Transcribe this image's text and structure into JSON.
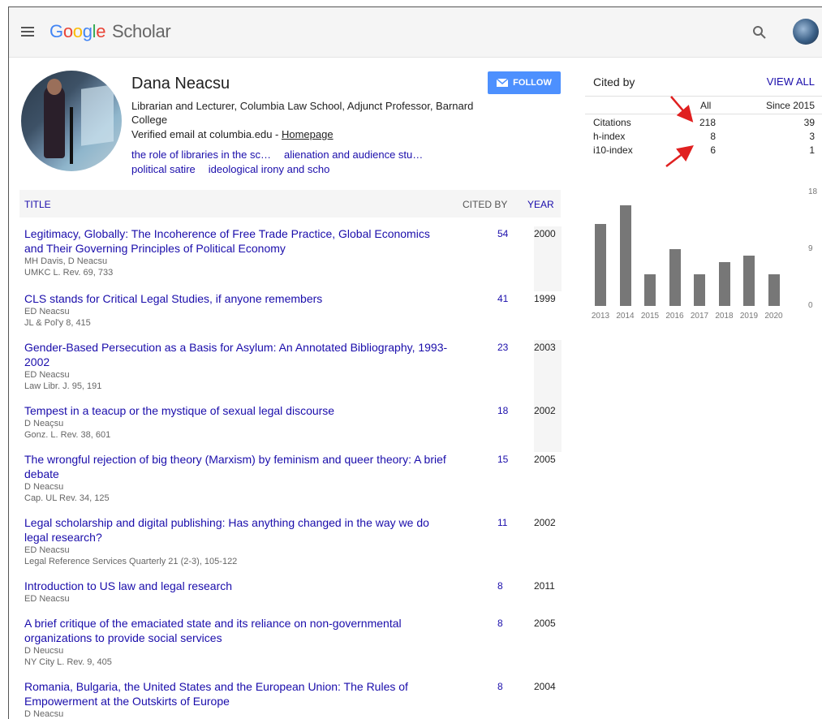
{
  "header": {
    "logo": {
      "g1": "G",
      "o1": "o",
      "o2": "o",
      "g2": "g",
      "l": "l",
      "e": "e",
      "scholar": "Scholar"
    },
    "menu_icon": "hamburger-menu-icon",
    "search_icon": "search-icon"
  },
  "profile": {
    "name": "Dana Neacsu",
    "affiliation": "Librarian and Lecturer, Columbia Law School, Adjunct Professor, Barnard College",
    "email_text": "Verified email at columbia.edu - ",
    "homepage_label": "Homepage",
    "interests": [
      "the role of libraries in the sc…",
      "alienation and audience stu…",
      "political satire",
      "ideological irony and scho"
    ],
    "follow_label": "FOLLOW"
  },
  "table": {
    "headers": {
      "title": "TITLE",
      "cited_by": "CITED BY",
      "year": "YEAR"
    },
    "rows": [
      {
        "title": "Legitimacy, Globally: The Incoherence of Free Trade Practice, Global Economics and Their Governing Principles of Political Economy",
        "authors": "MH Davis, D Neacsu",
        "venue": "UMKC L. Rev. 69, 733",
        "cited": "54",
        "year": "2000"
      },
      {
        "title": "CLS stands for Critical Legal Studies, if anyone remembers",
        "authors": "ED Neacsu",
        "venue": "JL & Pol'y 8, 415",
        "cited": "41",
        "year": "1999"
      },
      {
        "title": "Gender-Based Persecution as a Basis for Asylum: An Annotated Bibliography, 1993-2002",
        "authors": "ED Neacsu",
        "venue": "Law Libr. J. 95, 191",
        "cited": "23",
        "year": "2003"
      },
      {
        "title": "Tempest in a teacup or the mystique of sexual legal discourse",
        "authors": "D Neaçsu",
        "venue": "Gonz. L. Rev. 38, 601",
        "cited": "18",
        "year": "2002"
      },
      {
        "title": "The wrongful rejection of big theory (Marxism) by feminism and queer theory: A brief debate",
        "authors": "D Neacsu",
        "venue": "Cap. UL Rev. 34, 125",
        "cited": "15",
        "year": "2005"
      },
      {
        "title": "Legal scholarship and digital publishing: Has anything changed in the way we do legal research?",
        "authors": "ED Neacsu",
        "venue": "Legal Reference Services Quarterly 21 (2-3), 105-122",
        "cited": "11",
        "year": "2002"
      },
      {
        "title": "Introduction to US law and legal research",
        "authors": "ED Neacsu",
        "venue": "",
        "cited": "8",
        "year": "2011"
      },
      {
        "title": "A brief critique of the emaciated state and its reliance on non-governmental organizations to provide social services",
        "authors": "D Neucsu",
        "venue": "NY City L. Rev. 9, 405",
        "cited": "8",
        "year": "2005"
      },
      {
        "title": "Romania, Bulgaria, the United States and the European Union: The Rules of Empowerment at the Outskirts of Europe",
        "authors": "D Neacsu",
        "venue": "",
        "cited": "8",
        "year": "2004"
      }
    ]
  },
  "cited_by": {
    "label": "Cited by",
    "view_all": "VIEW ALL",
    "col_all": "All",
    "col_since": "Since 2015",
    "stats": [
      {
        "key": "Citations",
        "all": "218",
        "since": "39"
      },
      {
        "key": "h-index",
        "all": "8",
        "since": "3"
      },
      {
        "key": "i10-index",
        "all": "6",
        "since": "1"
      }
    ]
  },
  "chart_data": {
    "type": "bar",
    "categories": [
      "2013",
      "2014",
      "2015",
      "2016",
      "2017",
      "2018",
      "2019",
      "2020"
    ],
    "values": [
      13,
      16,
      5,
      9,
      5,
      7,
      8,
      5
    ],
    "ylim": [
      0,
      18
    ],
    "yticks": [
      "18",
      "9",
      "0"
    ],
    "bar_color": "#777777"
  },
  "colors": {
    "link": "#1a0dab",
    "follow_button": "#4d90fe",
    "annotation_arrow": "#e02020"
  }
}
